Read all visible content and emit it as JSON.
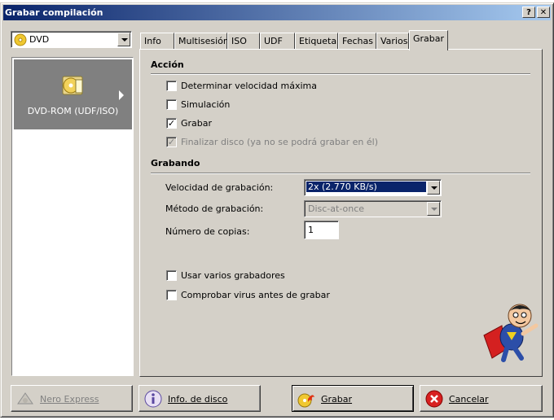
{
  "window": {
    "title": "Grabar compilación",
    "help_glyph": "?",
    "close_glyph": "✕"
  },
  "left": {
    "type_select": {
      "value": "DVD"
    },
    "items": [
      {
        "label": "DVD-ROM (UDF/ISO)"
      }
    ]
  },
  "tabs": [
    {
      "label": "Info"
    },
    {
      "label": "Multisesión"
    },
    {
      "label": "ISO"
    },
    {
      "label": "UDF"
    },
    {
      "label": "Etiqueta"
    },
    {
      "label": "Fechas"
    },
    {
      "label": "Varios"
    },
    {
      "label": "Grabar",
      "active": true
    }
  ],
  "accion": {
    "title": "Acción",
    "options": [
      {
        "label": "Determinar velocidad máxima",
        "checked": false,
        "disabled": false
      },
      {
        "label": "Simulación",
        "checked": false,
        "disabled": false
      },
      {
        "label": "Grabar",
        "checked": true,
        "disabled": false
      },
      {
        "label": "Finalizar disco (ya no se podrá grabar en él)",
        "checked": true,
        "disabled": true
      }
    ]
  },
  "grabando": {
    "title": "Grabando",
    "speed_label": "Velocidad de grabación:",
    "speed_value": "2x (2.770 KB/s)",
    "method_label": "Método de grabación:",
    "method_value": "Disc-at-once",
    "copies_label": "Número de copias:",
    "copies_value": "1"
  },
  "extra_options": [
    {
      "label": "Usar varios grabadores",
      "checked": false
    },
    {
      "label": "Comprobar virus antes de grabar",
      "checked": false
    }
  ],
  "buttons": {
    "nero_express": "Nero Express",
    "disc_info": "Info. de disco",
    "burn": "Grabar",
    "cancel": "Cancelar"
  },
  "icons": {
    "type_select": "dvd-disc-icon",
    "left_item": "dvd-folder-icon",
    "nero_express": "nero-express-icon",
    "disc_info": "info-icon",
    "burn": "burn-flame-icon",
    "cancel": "cancel-icon",
    "mascot": "superhero-mascot-icon"
  },
  "colors": {
    "title_bar": "#0a246a",
    "selection": "#0a246a",
    "face": "#d4d0c8"
  }
}
